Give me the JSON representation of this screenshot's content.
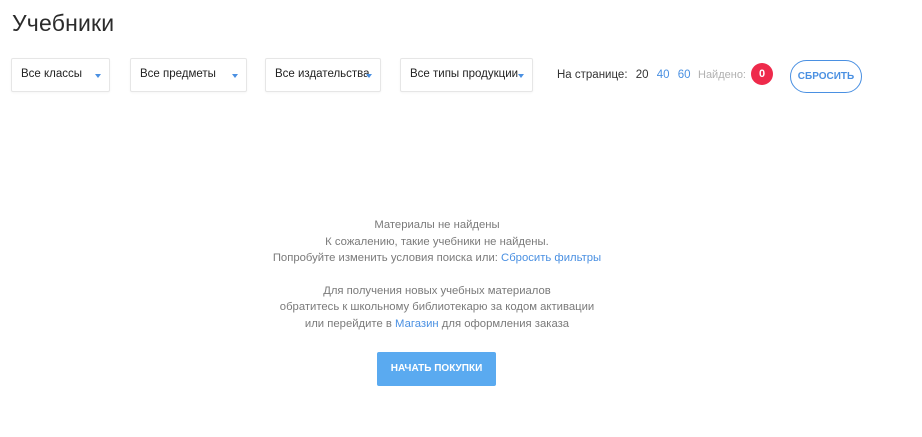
{
  "page": {
    "title": "Учебники"
  },
  "filters": [
    {
      "label": "Все классы"
    },
    {
      "label": "Все предметы"
    },
    {
      "label": "Все издательства"
    },
    {
      "label": "Все типы продукции"
    }
  ],
  "pagination": {
    "label": "На странице:",
    "options": [
      "20",
      "40",
      "60"
    ],
    "selected": "20"
  },
  "found": {
    "label": "Найдено:",
    "count": "0"
  },
  "reset_button": "СБРОСИТЬ",
  "empty_state": {
    "title": "Материалы не найдены",
    "line1": "К сожалению, такие учебники не найдены.",
    "line2_prefix": "Попробуйте изменить условия поиска или:",
    "line2_link": "Сбросить фильтры",
    "line3": "Для получения новых учебных материалов",
    "line4": "обратитесь к школьному библиотекарю за кодом активации",
    "line5_prefix": "или перейдите в",
    "line5_link": "Магазин",
    "line5_suffix": "для оформления заказа"
  },
  "cta_button": "НАЧАТЬ ПОКУПКИ",
  "colors": {
    "accent": "#4a90e2",
    "badge": "#ee2a4b",
    "cta": "#5aaaf0"
  }
}
